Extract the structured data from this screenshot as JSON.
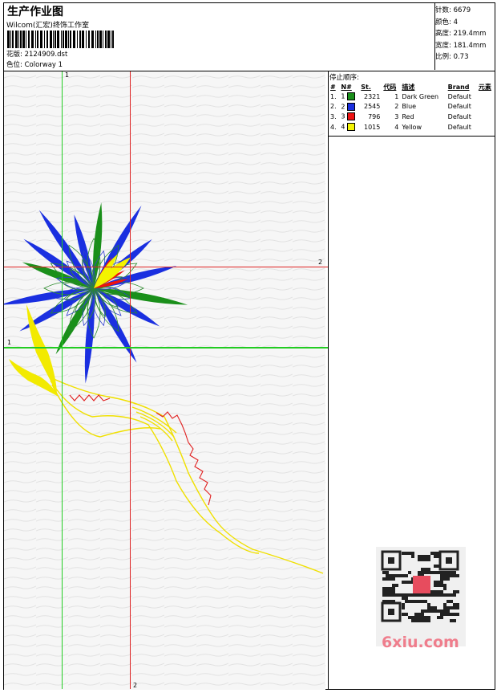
{
  "header": {
    "title": "生产作业图",
    "company": "Wilcom(汇宏)终饰工作室",
    "design_label": "花版: 2124909.dst",
    "colorway_label": "色位: Colorway 1"
  },
  "stats": {
    "stitches": "针数: 6679",
    "colors": "颜色: 4",
    "height": "高度: 219.4mm",
    "width": "宽度: 181.4mm",
    "scale": "比例: 0.73"
  },
  "stop_sequence": {
    "title": "停止顺序:",
    "headers": [
      "#",
      "N#",
      "St.",
      "代码",
      "描述",
      "Brand",
      "元素"
    ],
    "rows": [
      {
        "idx": "1.",
        "n": "1",
        "color": "#1a8f1a",
        "st": "2321",
        "code": "1",
        "desc": "Dark Green",
        "brand": "Default"
      },
      {
        "idx": "2.",
        "n": "2",
        "color": "#1a2fe0",
        "st": "2545",
        "code": "2",
        "desc": "Blue",
        "brand": "Default"
      },
      {
        "idx": "3.",
        "n": "3",
        "color": "#ee1111",
        "st": "796",
        "code": "3",
        "desc": "Red",
        "brand": "Default"
      },
      {
        "idx": "4.",
        "n": "4",
        "color": "#f3f300",
        "st": "1015",
        "code": "4",
        "desc": "Yellow",
        "brand": "Default"
      }
    ]
  },
  "guides": {
    "v_green": "1",
    "v_red": "2",
    "h_green": "1",
    "h_red": "2"
  },
  "watermark": "6xiu.com",
  "colors": {
    "guide_green": "#22cc22",
    "guide_red": "#dd2222"
  }
}
